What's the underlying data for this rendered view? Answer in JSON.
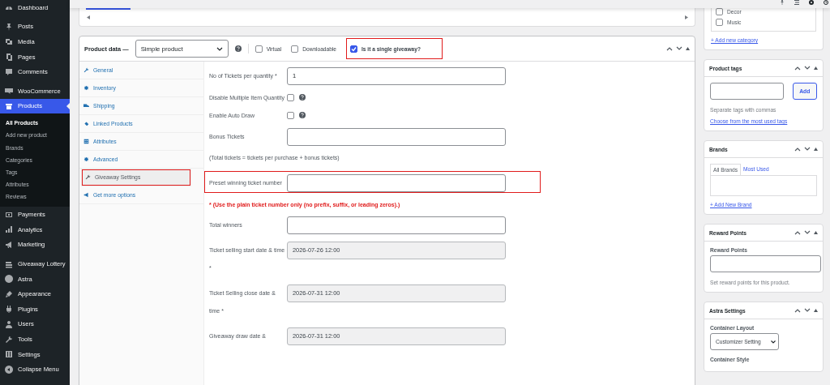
{
  "sidebar": {
    "sections": [
      [
        {
          "label": "Dashboard",
          "selected": false
        }
      ],
      [
        {
          "label": "Posts",
          "selected": false
        },
        {
          "label": "Media",
          "selected": false
        },
        {
          "label": "Pages",
          "selected": false
        },
        {
          "label": "Comments",
          "selected": false
        }
      ],
      [
        {
          "label": "WooCommerce",
          "selected": false
        },
        {
          "label": "Products",
          "selected": true,
          "children": [
            {
              "label": "All Products",
              "selected": true
            },
            {
              "label": "Add new product",
              "selected": false
            },
            {
              "label": "Brands",
              "selected": false
            },
            {
              "label": "Categories",
              "selected": false
            },
            {
              "label": "Tags",
              "selected": false
            },
            {
              "label": "Attributes",
              "selected": false
            },
            {
              "label": "Reviews",
              "selected": false
            }
          ]
        },
        {
          "label": "Payments",
          "selected": false
        },
        {
          "label": "Analytics",
          "selected": false
        },
        {
          "label": "Marketing",
          "selected": false
        }
      ],
      [
        {
          "label": "Giveaway Lottery",
          "selected": false
        },
        {
          "label": "Astra",
          "selected": false
        },
        {
          "label": "Appearance",
          "selected": false
        },
        {
          "label": "Plugins",
          "selected": false
        },
        {
          "label": "Users",
          "selected": false
        },
        {
          "label": "Tools",
          "selected": false
        },
        {
          "label": "Settings",
          "selected": false
        },
        {
          "label": "Collapse Menu",
          "selected": false
        }
      ]
    ]
  },
  "product_data": {
    "title": "Product data —",
    "product_type": "Simple product",
    "options": [
      {
        "label": "Virtual",
        "checked": false,
        "highlighted": false
      },
      {
        "label": "Downloadable",
        "checked": false,
        "highlighted": false
      },
      {
        "label": "Is it a single giveaway?",
        "checked": true,
        "highlighted": true
      }
    ],
    "tabs": [
      {
        "label": "General",
        "selected": false,
        "highlighted": false
      },
      {
        "label": "Inventory",
        "selected": false,
        "highlighted": false
      },
      {
        "label": "Shipping",
        "selected": false,
        "highlighted": false
      },
      {
        "label": "Linked Products",
        "selected": false,
        "highlighted": false
      },
      {
        "label": "Attributes",
        "selected": false,
        "highlighted": false
      },
      {
        "label": "Advanced",
        "selected": false,
        "highlighted": false
      },
      {
        "label": "Giveaway Settings",
        "selected": true,
        "highlighted": true
      },
      {
        "label": "Get more options",
        "selected": false,
        "highlighted": false
      }
    ],
    "fields": [
      {
        "kind": "input",
        "label": "No of Tickets per quantity *",
        "value": "1",
        "readonly": false,
        "highlighted": false
      },
      {
        "kind": "checkbox",
        "label": "Disable Multiple Item Quantity",
        "checked": false,
        "highlighted": false
      },
      {
        "kind": "checkbox",
        "label": "Enable Auto Draw",
        "checked": false,
        "highlighted": false
      },
      {
        "kind": "input",
        "label": "Bonus Tickets",
        "readonly": false,
        "highlighted": false
      },
      {
        "kind": "note",
        "text": "(Total tickets = tickets per purchase + bonus tickets)"
      },
      {
        "kind": "input",
        "label": "Preset winning ticket number",
        "readonly": false,
        "highlighted": true
      },
      {
        "kind": "warning",
        "text": "* (Use the plain ticket number only (no prefix, suffix, or leading zeros).)"
      },
      {
        "kind": "input",
        "label": "Total winners",
        "readonly": false,
        "highlighted": false
      },
      {
        "kind": "input",
        "label": "Ticket selling start date & time *",
        "value": "2026-07-26 12:00",
        "readonly": true,
        "highlighted": false
      },
      {
        "kind": "input",
        "label": "Ticket Selling close date & time *",
        "value": "2026-07-31 12:00",
        "readonly": true,
        "highlighted": false
      },
      {
        "kind": "input",
        "label": "Giveaway draw date &",
        "value": "2026-07-31 12:00",
        "readonly": true,
        "highlighted": false
      }
    ]
  },
  "categories": {
    "items": [
      {
        "label": "Decor",
        "checked": false
      },
      {
        "label": "Music",
        "checked": false
      }
    ],
    "add_link": "+ Add new category"
  },
  "product_tags": {
    "title": "Product tags",
    "button": "Add",
    "hint": "Separate tags with commas",
    "link": "Choose from the most used tags"
  },
  "brands": {
    "title": "Brands",
    "tabs": [
      {
        "label": "All Brands",
        "selected": true
      },
      {
        "label": "Most Used",
        "selected": false
      }
    ],
    "add_link": "+ Add New Brand"
  },
  "reward_points": {
    "title": "Reward Points",
    "label": "Reward Points",
    "hint": "Set reward points for this product."
  },
  "astra_settings": {
    "title": "Astra Settings",
    "container_layout": {
      "label": "Container Layout",
      "value": "Customizer Setting"
    },
    "container_style": {
      "label": "Container Style"
    }
  }
}
